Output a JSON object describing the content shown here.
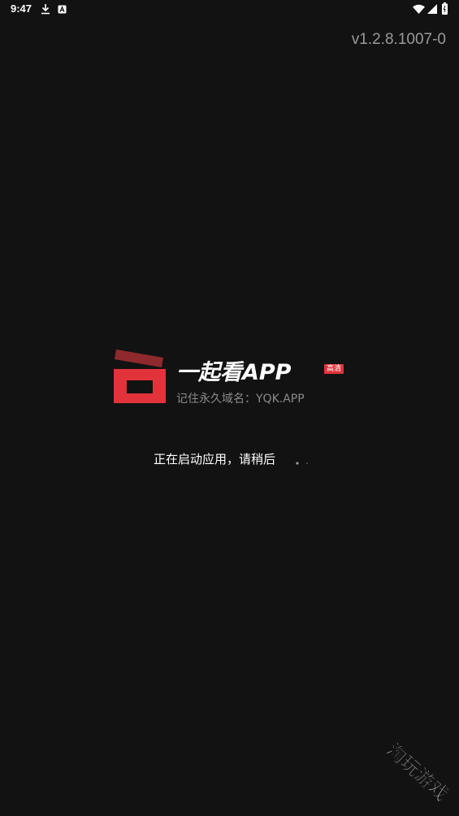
{
  "status_bar": {
    "time": "9:47",
    "icons": [
      "download-icon",
      "a-icon",
      "wifi-icon",
      "signal-icon",
      "battery-icon"
    ]
  },
  "version": "v1.2.8.1007-0",
  "logo": {
    "app_name": "一起看APP",
    "badge": "高清",
    "slogan": "记住永久域名：YQK.APP",
    "brand_color": "#e2333b",
    "brand_dark_color": "#8e2a2e"
  },
  "loading": {
    "text": "正在启动应用，请稍后"
  },
  "watermark": {
    "text": "淘玩游戏"
  }
}
